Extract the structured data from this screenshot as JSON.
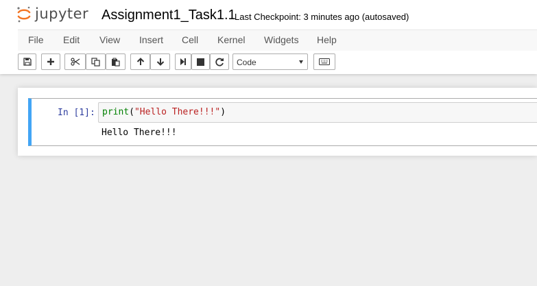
{
  "header": {
    "logo_text": "jupyter",
    "notebook_title": "Assignment1_Task1.1",
    "checkpoint_text": "Last Checkpoint: 3 minutes ago (autosaved)"
  },
  "menu": {
    "items": [
      "File",
      "Edit",
      "View",
      "Insert",
      "Cell",
      "Kernel",
      "Widgets",
      "Help"
    ]
  },
  "toolbar": {
    "icons": [
      "save-icon",
      "plus-icon",
      "scissors-icon",
      "copy-icon",
      "paste-icon",
      "arrow-up-icon",
      "arrow-down-icon",
      "step-forward-icon",
      "stop-icon",
      "restart-icon",
      "keyboard-icon"
    ],
    "cell_type_selected": "Code"
  },
  "cell": {
    "prompt": "In [1]:",
    "code_func": "print",
    "code_open": "(",
    "code_string": "\"Hello There!!!\"",
    "code_close": ")",
    "output": "Hello There!!!"
  },
  "colors": {
    "accent_blue": "#42a5f5",
    "prompt_blue": "#303f9f",
    "keyword_green": "#008000",
    "string_red": "#ba2121",
    "logo_orange": "#f37626"
  }
}
